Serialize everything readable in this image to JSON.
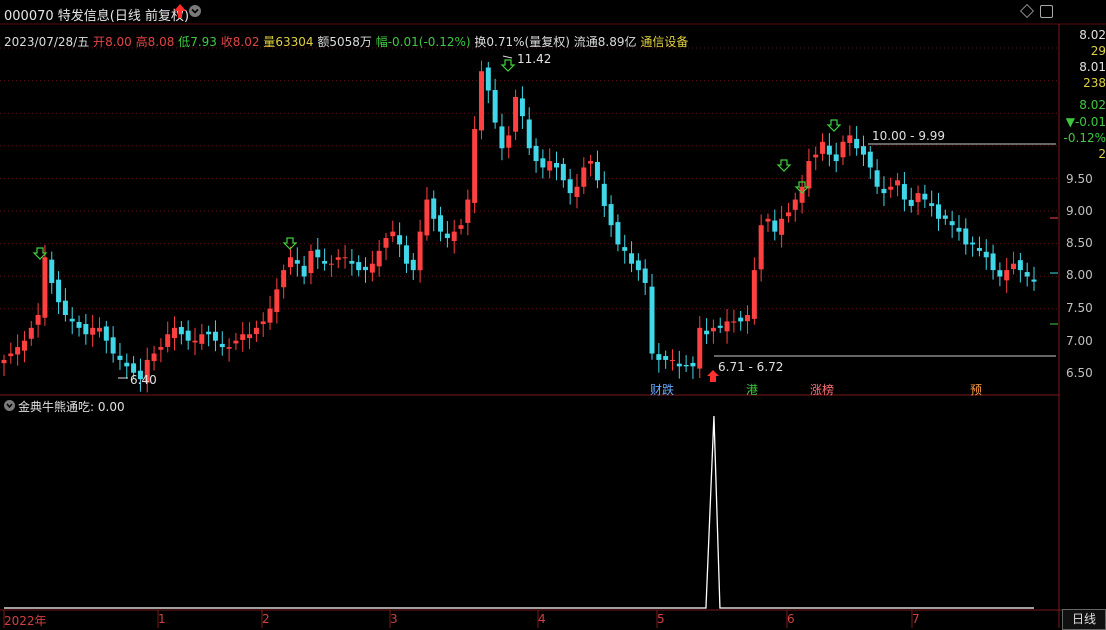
{
  "header": {
    "code": "000070",
    "name": "特发信息",
    "mode": "(日线 前复权)",
    "up_color": "#ff2a2a"
  },
  "info": {
    "date": "2023/07/28/五",
    "open_label": "开",
    "open": "8.00",
    "high_label": "高",
    "high": "8.08",
    "low_label": "低",
    "low": "7.93",
    "close_label": "收",
    "close": "8.02",
    "vol_label": "量",
    "vol": "63304",
    "amount": "额5058万",
    "change_label": "幅",
    "change": "-0.01(-0.12%)",
    "turnover": "换0.71%(量复权)",
    "float_cap": "流通8.89亿",
    "industry": "通信设备"
  },
  "right_panel": {
    "quote": [
      "8.02",
      "29",
      "8.01",
      "238",
      "8.02",
      "▼-0.01",
      "-0.12%",
      "2"
    ],
    "price_ticks": [
      "9.50",
      "9.00",
      "8.50",
      "8.00",
      "7.50",
      "7.00",
      "6.50"
    ]
  },
  "annotations": {
    "high_mark": "11.42",
    "low_mark": "6.40",
    "range_upper": "10.00 - 9.99",
    "range_lower": "6.71 - 6.72"
  },
  "events": [
    "财跌",
    "港",
    "涨榜",
    "预"
  ],
  "sub_chart": {
    "indicator": "金典牛熊通吃",
    "value": ": 0.00"
  },
  "x_axis": [
    "2022年",
    "1",
    "2",
    "3",
    "4",
    "5",
    "6",
    "7"
  ],
  "period_button": "日线",
  "chart_data": {
    "type": "candlestick",
    "ylim": [
      6.3,
      11.6
    ],
    "closes": [
      6.8,
      6.9,
      7.0,
      7.1,
      7.3,
      7.5,
      8.4,
      8.0,
      7.7,
      7.5,
      7.4,
      7.3,
      7.2,
      7.3,
      7.3,
      7.1,
      6.9,
      6.8,
      6.7,
      6.6,
      6.5,
      6.8,
      6.9,
      7.0,
      7.2,
      7.3,
      7.2,
      7.1,
      7.1,
      7.2,
      7.2,
      7.1,
      7.0,
      7.0,
      7.1,
      7.2,
      7.2,
      7.3,
      7.4,
      7.6,
      7.9,
      8.2,
      8.4,
      8.3,
      8.1,
      8.5,
      8.4,
      8.3,
      8.3,
      8.4,
      8.4,
      8.3,
      8.2,
      8.2,
      8.3,
      8.5,
      8.7,
      8.8,
      8.6,
      8.3,
      8.2,
      8.8,
      9.3,
      9.0,
      8.8,
      8.7,
      8.8,
      8.9,
      9.3,
      10.4,
      11.3,
      11.0,
      10.5,
      10.1,
      10.3,
      10.9,
      10.6,
      10.1,
      9.9,
      9.8,
      9.9,
      9.8,
      9.6,
      9.4,
      9.5,
      9.8,
      9.9,
      9.6,
      9.2,
      8.9,
      8.6,
      8.5,
      8.3,
      8.2,
      8.0,
      6.9,
      6.8,
      6.8,
      6.8,
      6.7,
      6.7,
      6.7,
      7.3,
      7.2,
      7.3,
      7.3,
      7.4,
      7.4,
      7.4,
      7.5,
      8.2,
      8.9,
      9.0,
      8.8,
      9.0,
      9.1,
      9.3,
      9.5,
      9.9,
      10.0,
      10.2,
      10.0,
      9.9,
      10.2,
      10.3,
      10.1,
      10.0,
      9.8,
      9.5,
      9.4,
      9.5,
      9.6,
      9.3,
      9.2,
      9.4,
      9.3,
      9.2,
      9.0,
      9.0,
      8.9,
      8.8,
      8.6,
      8.6,
      8.5,
      8.4,
      8.2,
      8.1,
      8.2,
      8.3,
      8.2,
      8.1,
      8.02
    ],
    "signal_peak_index": 101
  }
}
